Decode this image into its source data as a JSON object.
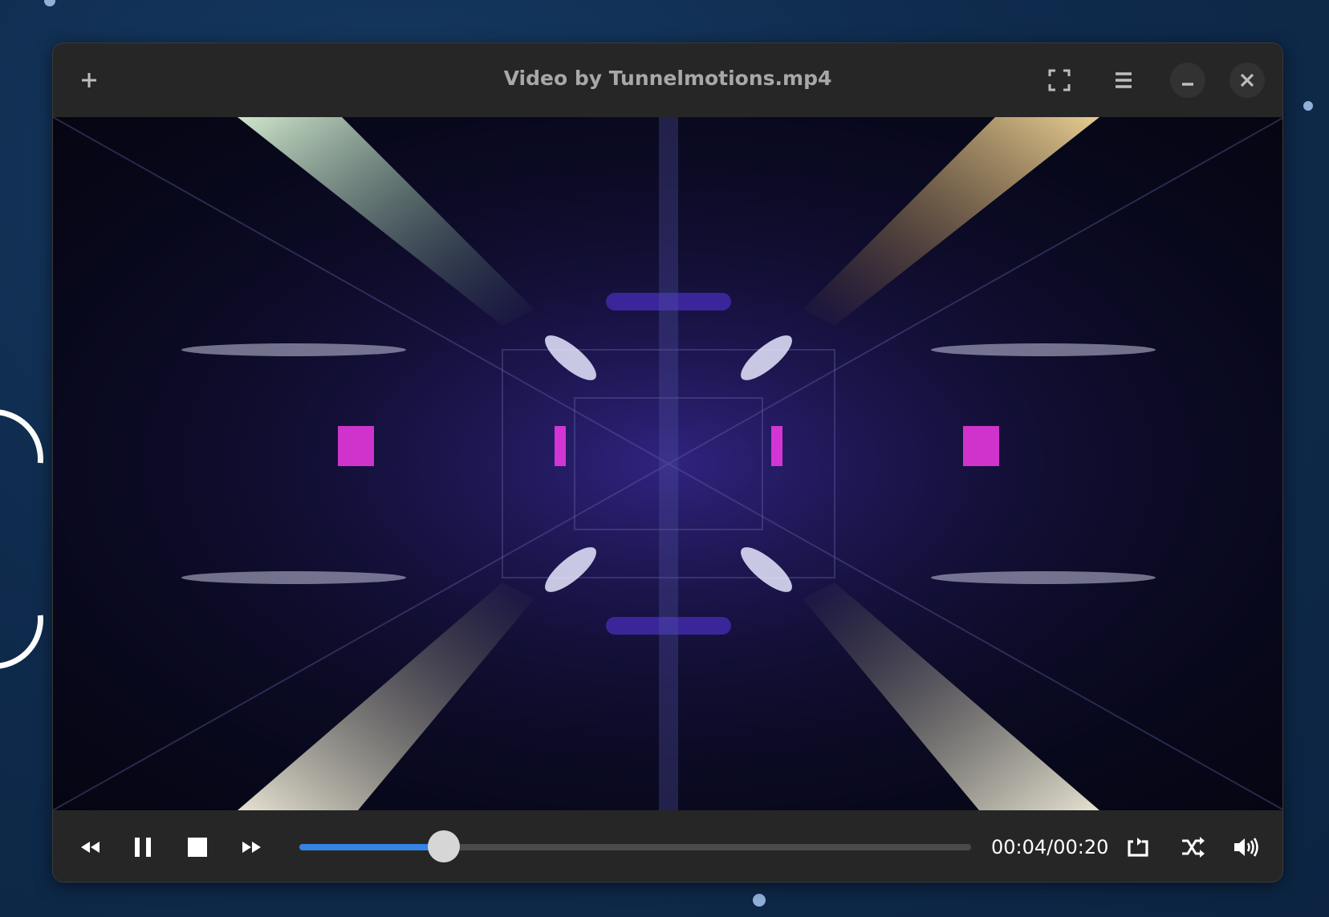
{
  "window": {
    "title": "Video by Tunnelmotions.mp4"
  },
  "header": {
    "buttons": [
      {
        "name": "add",
        "icon": "plus-icon"
      },
      {
        "name": "fullscreen",
        "icon": "fullscreen-icon"
      },
      {
        "name": "menu",
        "icon": "hamburger-menu-icon"
      },
      {
        "name": "minimize",
        "icon": "minimize-icon"
      },
      {
        "name": "close",
        "icon": "close-icon"
      }
    ]
  },
  "player": {
    "current_time": "00:04",
    "separator": "/",
    "duration": "00:20",
    "progress": 0.215,
    "accent_color": "#3584e4"
  }
}
